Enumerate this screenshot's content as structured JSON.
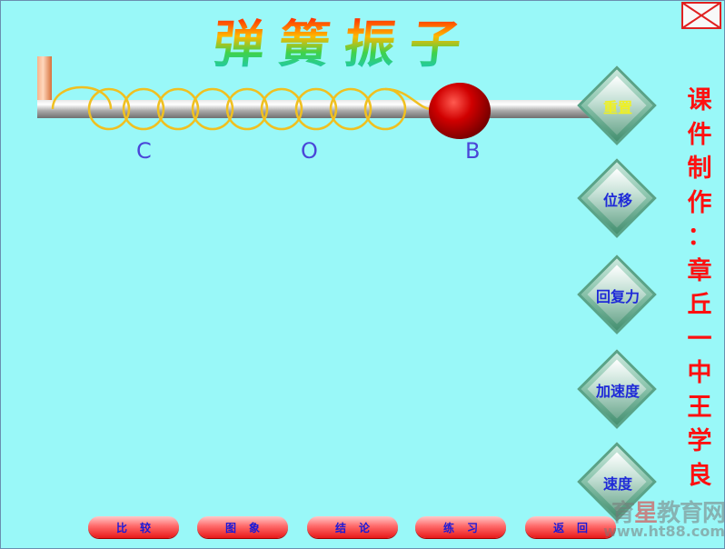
{
  "title_chars": [
    "弹",
    "簧",
    "振",
    "子"
  ],
  "point_labels": {
    "c": "C",
    "o": "O",
    "b": "B"
  },
  "side_buttons": [
    {
      "label": "重置",
      "state": "active"
    },
    {
      "label": "位移"
    },
    {
      "label": "回复力"
    },
    {
      "label": "加速度"
    },
    {
      "label": "速度"
    }
  ],
  "credit_chars": [
    "课",
    "件",
    "制",
    "作",
    "：",
    "章",
    "丘",
    "一",
    "中",
    "王",
    "学",
    "良"
  ],
  "bottom_buttons": [
    "比较",
    "图象",
    "结论",
    "练习",
    "返回"
  ],
  "watermark": {
    "part1": "育",
    "part2": "星",
    "part3": "教育网",
    "url": "www.ht88.com"
  },
  "colors": {
    "background": "#99f8f8",
    "ball": "#d00000",
    "spring": "#f0c020",
    "label": "#4a46d8",
    "credit": "#ff1010"
  }
}
